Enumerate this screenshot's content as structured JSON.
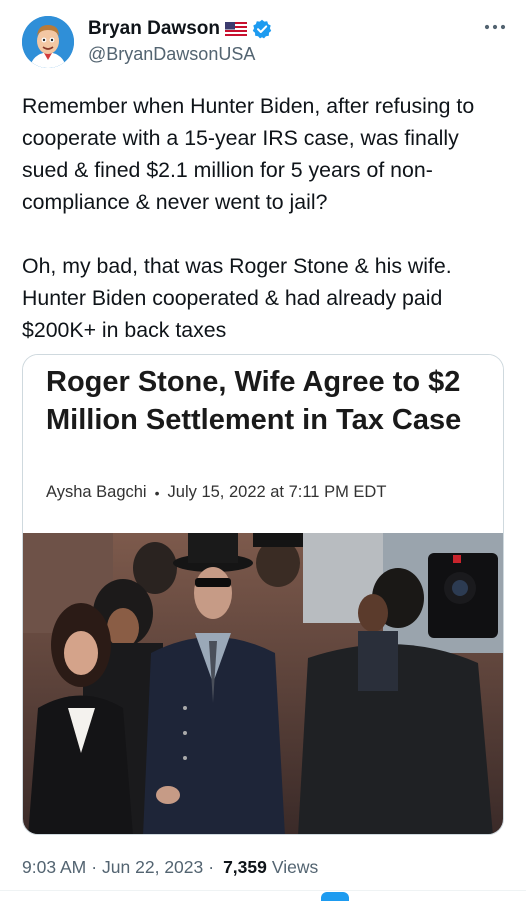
{
  "author": {
    "name": "Bryan Dawson",
    "handle": "@BryanDawsonUSA",
    "flag_icon": "us-flag-icon",
    "verified_icon": "verified-badge-icon",
    "verified_color": "#1d9bf0"
  },
  "menu": {
    "icon": "more-dots-icon"
  },
  "tweet": {
    "paragraph_1": "Remember when Hunter Biden, after refusing to\ncooperate with a 15-year IRS case, was finally\nsued & fined $2.1 million for 5 years of non-\ncompliance & never went to jail?",
    "paragraph_2": "Oh, my bad, that was Roger Stone & his wife.\nHunter Biden cooperated & had already paid\n$200K+ in back taxes"
  },
  "card": {
    "headline": "Roger Stone, Wife Agree to $2 Million Settlement in Tax Case",
    "author": "Aysha Bagchi",
    "date": "July 15, 2022 at 7:11 PM EDT",
    "separator": "•"
  },
  "meta": {
    "time": "9:03 AM",
    "date": "Jun 22, 2023",
    "separator": "·",
    "views_count": "7,359",
    "views_label": "Views"
  }
}
